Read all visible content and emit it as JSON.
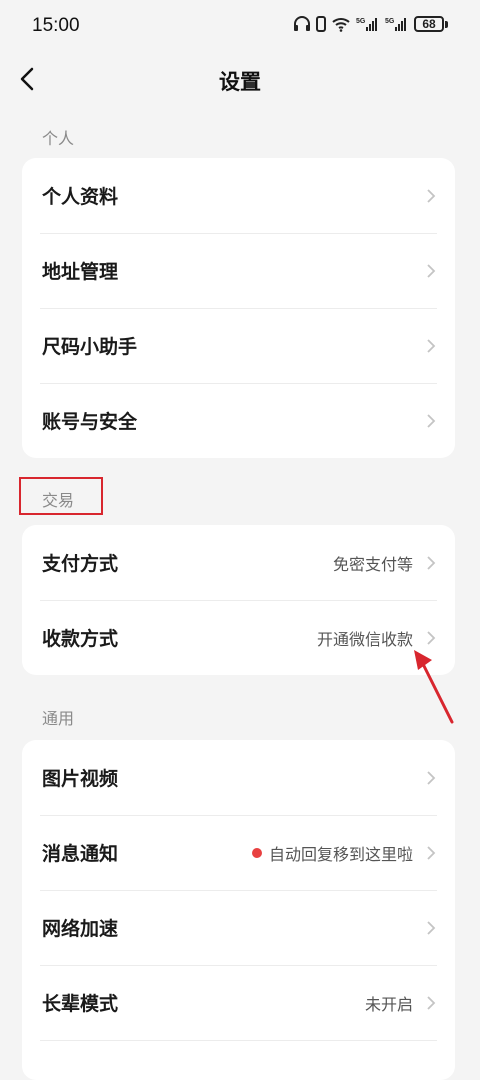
{
  "status_bar": {
    "time": "15:00",
    "battery": "68",
    "icons": [
      "headphones-icon",
      "vibrate-icon",
      "wifi-icon",
      "signal-5g-icon",
      "signal-5g-icon",
      "battery-icon"
    ]
  },
  "nav": {
    "title": "设置",
    "back_icon": "back-arrow-icon"
  },
  "sections": [
    {
      "label": "个人",
      "items": [
        {
          "label": "个人资料",
          "value": ""
        },
        {
          "label": "地址管理",
          "value": ""
        },
        {
          "label": "尺码小助手",
          "value": ""
        },
        {
          "label": "账号与安全",
          "value": ""
        }
      ]
    },
    {
      "label": "交易",
      "items": [
        {
          "label": "支付方式",
          "value": "免密支付等"
        },
        {
          "label": "收款方式",
          "value": "开通微信收款"
        }
      ]
    },
    {
      "label": "通用",
      "items": [
        {
          "label": "图片视频",
          "value": ""
        },
        {
          "label": "消息通知",
          "value": "自动回复移到这里啦"
        },
        {
          "label": "网络加速",
          "value": ""
        },
        {
          "label": "长辈模式",
          "value": "未开启"
        }
      ]
    }
  ],
  "colors": {
    "background": "#f4f4f4",
    "card": "#ffffff",
    "annotation": "#d8262e",
    "notification_dot": "#e84040"
  }
}
